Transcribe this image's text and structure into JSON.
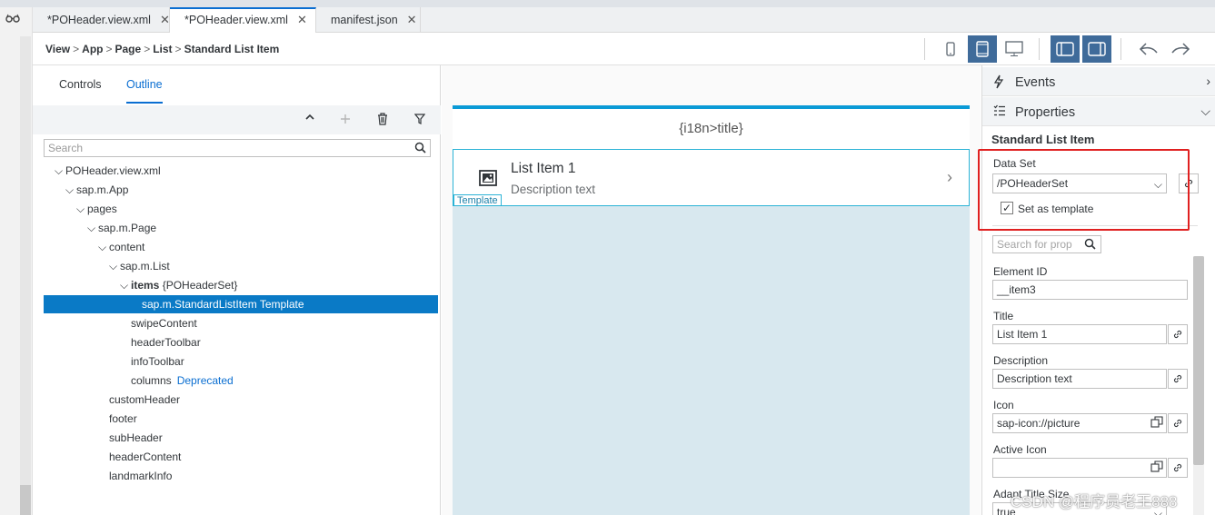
{
  "tabs": [
    {
      "label": "*POHeader.view.xml",
      "close": "✕"
    },
    {
      "label": "*POHeader.view.xml",
      "close": "✕"
    },
    {
      "label": "manifest.json",
      "close": "✕"
    }
  ],
  "breadcrumb": [
    "View",
    "App",
    "Page",
    "List",
    "Standard List Item"
  ],
  "left_panel": {
    "tabs": [
      "Controls",
      "Outline"
    ],
    "search_placeholder": "Search",
    "tree": [
      {
        "label": "POHeader.view.xml"
      },
      {
        "label": "sap.m.App"
      },
      {
        "label": "pages"
      },
      {
        "label": "sap.m.Page"
      },
      {
        "label": "content"
      },
      {
        "label": "sap.m.List"
      },
      {
        "label": "items",
        "extra": "{POHeaderSet}"
      },
      {
        "label": "sap.m.StandardListItem  Template"
      },
      {
        "label": "swipeContent"
      },
      {
        "label": "headerToolbar"
      },
      {
        "label": "infoToolbar"
      },
      {
        "label": "columns",
        "extra": "Deprecated"
      },
      {
        "label": "customHeader"
      },
      {
        "label": "footer"
      },
      {
        "label": "subHeader"
      },
      {
        "label": "headerContent"
      },
      {
        "label": "landmarkInfo"
      }
    ]
  },
  "canvas": {
    "header_title": "{i18n>title}",
    "item_title": "List Item 1",
    "item_description": "Description text",
    "badge": "Template"
  },
  "right_panel": {
    "events_label": "Events",
    "properties_label": "Properties",
    "heading": "Standard List Item",
    "data_set_label": "Data Set",
    "data_set_value": "/POHeaderSet",
    "set_as_template_label": "Set as template",
    "set_as_template_checked": true,
    "search_placeholder": "Search for prop",
    "fields": [
      {
        "label": "Element ID",
        "value": "__item3"
      },
      {
        "label": "Title",
        "value": "List Item 1"
      },
      {
        "label": "Description",
        "value": "Description text"
      },
      {
        "label": "Icon",
        "value": "sap-icon://picture"
      },
      {
        "label": "Active Icon",
        "value": ""
      },
      {
        "label": "Adapt Title Size",
        "value": "true"
      }
    ]
  },
  "watermark": "CSDN @程序员老王888",
  "colors": {
    "accent": "#0a6ed1",
    "selection": "#0a7ac6",
    "highlight_box": "#e02020"
  }
}
